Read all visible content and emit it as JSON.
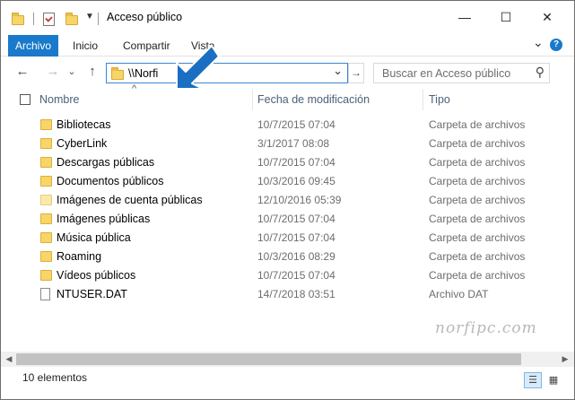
{
  "window": {
    "title": "Acceso público",
    "minimize_glyph": "—",
    "maximize_glyph": "☐",
    "close_glyph": "✕"
  },
  "ribbon": {
    "tabs": [
      "Archivo",
      "Inicio",
      "Compartir",
      "Vista"
    ],
    "expand_glyph": "⌄",
    "help_glyph": "?"
  },
  "nav": {
    "back_glyph": "←",
    "forward_glyph": "→",
    "recent_glyph": "⌄",
    "up_glyph": "↑",
    "address": "\\\\Norfi",
    "address_dropdown_glyph": "⌄",
    "go_glyph": "→",
    "search_placeholder": "Buscar en Acceso público",
    "search_glyph": "⚲"
  },
  "columns": {
    "name": "Nombre",
    "date": "Fecha de modificación",
    "type": "Tipo",
    "sort_glyph": "^"
  },
  "items": [
    {
      "name": "Bibliotecas",
      "date": "10/7/2015 07:04",
      "type": "Carpeta de archivos",
      "icon": "folder-icon"
    },
    {
      "name": "CyberLink",
      "date": "3/1/2017 08:08",
      "type": "Carpeta de archivos",
      "icon": "folder-icon"
    },
    {
      "name": "Descargas públicas",
      "date": "10/7/2015 07:04",
      "type": "Carpeta de archivos",
      "icon": "folder-icon"
    },
    {
      "name": "Documentos públicos",
      "date": "10/3/2016 09:45",
      "type": "Carpeta de archivos",
      "icon": "folder-icon"
    },
    {
      "name": "Imágenes de cuenta públicas",
      "date": "12/10/2016 05:39",
      "type": "Carpeta de archivos",
      "icon": "folder-light-icon"
    },
    {
      "name": "Imágenes públicas",
      "date": "10/7/2015 07:04",
      "type": "Carpeta de archivos",
      "icon": "folder-icon"
    },
    {
      "name": "Música pública",
      "date": "10/7/2015 07:04",
      "type": "Carpeta de archivos",
      "icon": "folder-icon"
    },
    {
      "name": "Roaming",
      "date": "10/3/2016 08:29",
      "type": "Carpeta de archivos",
      "icon": "folder-icon"
    },
    {
      "name": "Vídeos públicos",
      "date": "10/7/2015 07:04",
      "type": "Carpeta de archivos",
      "icon": "folder-icon"
    },
    {
      "name": "NTUSER.DAT",
      "date": "14/7/2018 03:51",
      "type": "Archivo DAT",
      "icon": "file-icon"
    }
  ],
  "scrollbar": {
    "left_glyph": "◀",
    "right_glyph": "▶"
  },
  "watermark": "norfipc.com",
  "status": {
    "count": "10 elementos",
    "details_view_glyph": "☰",
    "icons_view_glyph": "▦"
  },
  "colors": {
    "accent": "#1979ca",
    "arrow": "#1a6fc2",
    "header_text": "#4c607a",
    "folder": "#f7d568"
  }
}
